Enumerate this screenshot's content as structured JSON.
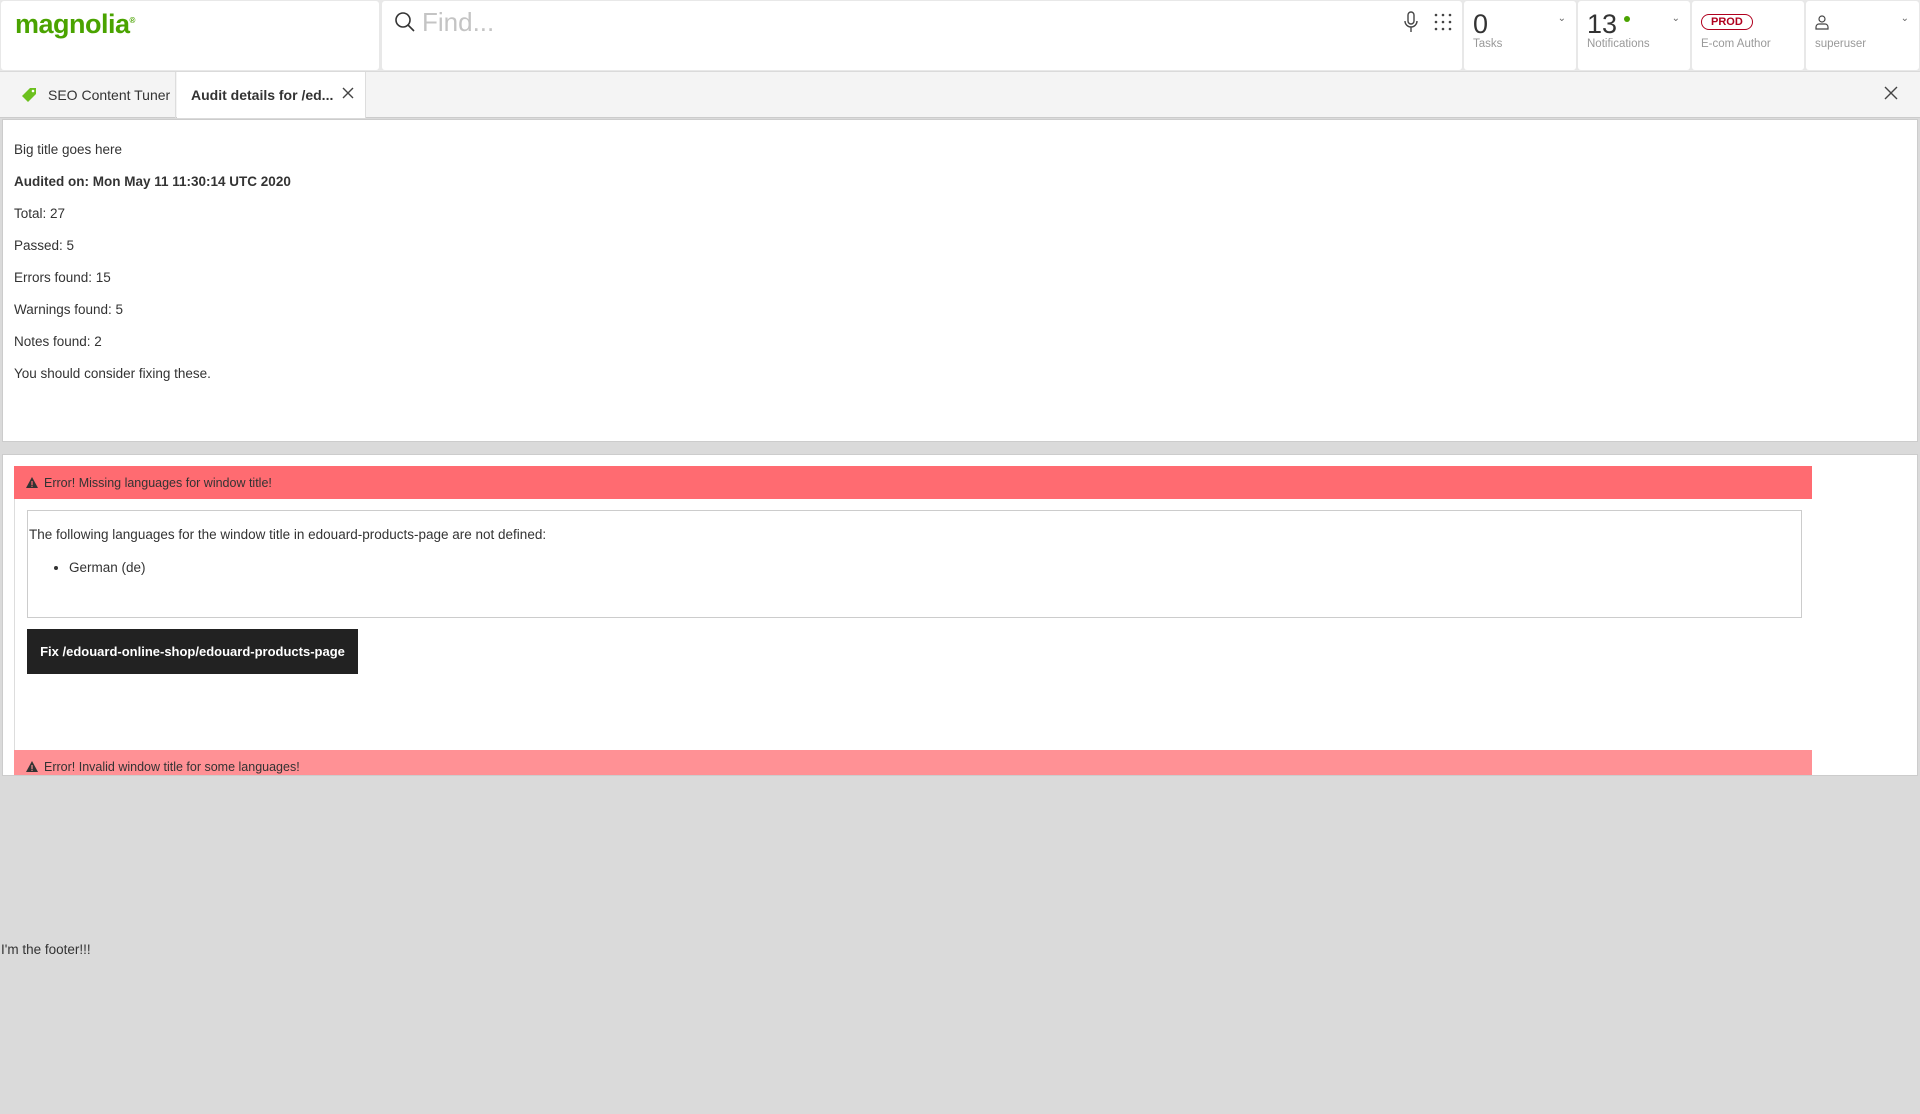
{
  "header": {
    "logo": "magnolia",
    "search": {
      "placeholder": "Find...",
      "value": ""
    },
    "tasks": {
      "count": "0",
      "label": "Tasks"
    },
    "notifications": {
      "count": "13",
      "label": "Notifications",
      "dot_color": "#4aa300"
    },
    "environment": {
      "badge": "PROD",
      "label": "E-com Author",
      "color": "#b0001e"
    },
    "user": {
      "label": "superuser"
    }
  },
  "tabs": [
    {
      "label": "SEO Content Tuner",
      "icon": "seo-tag-icon"
    },
    {
      "label": "Audit details for /ed...",
      "active": true
    }
  ],
  "summary": {
    "title": "Big title goes here",
    "audited_on": "Audited on: Mon May 11 11:30:14 UTC 2020",
    "total": "Total: 27",
    "passed": "Passed: 5",
    "errors": "Errors found: 15",
    "warnings": "Warnings found: 5",
    "notes": "Notes found: 2",
    "advice": "You should consider fixing these."
  },
  "issues": [
    {
      "title": "Error! Missing languages for window title!",
      "color": "#ff6b71",
      "description": "The following languages for the window title in edouard-products-page are not defined:",
      "items": [
        "German (de)"
      ],
      "fix_label": "Fix /edouard-online-shop/edouard-products-page"
    },
    {
      "title": "Error! Invalid window title for some languages!",
      "color": "#ff9195"
    }
  ],
  "footer": {
    "text": "I'm the footer!!!"
  }
}
